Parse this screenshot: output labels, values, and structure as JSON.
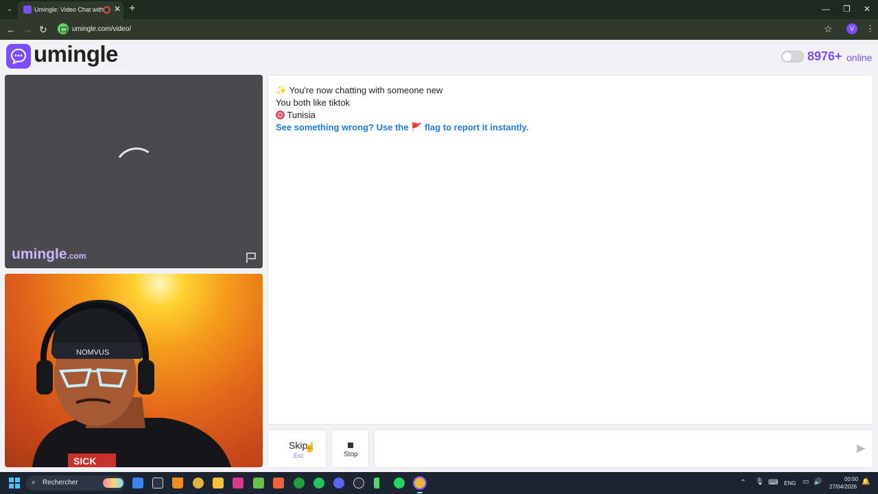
{
  "browser": {
    "tab_title": "Umingle: Video Chat with S",
    "url": "umingle.com/video/",
    "profile_initial": "V"
  },
  "header": {
    "logo_text": "umingle",
    "online_count": "8976+",
    "online_label": "online",
    "toggle_on": false
  },
  "remote_video": {
    "watermark": "umingle",
    "watermark_tld": ".com",
    "loading": true
  },
  "chat": {
    "line1_icon": "✨",
    "line1": "You're now chatting with someone new",
    "line2": "You both like tiktok",
    "country": "Tunisia",
    "report_prefix": "See something wrong? Use the",
    "report_flag": "🚩",
    "report_suffix": "flag to report it instantly."
  },
  "controls": {
    "skip_label": "Skip",
    "skip_key": "Esc",
    "stop_label": "Stop",
    "message_placeholder": ""
  },
  "taskbar": {
    "search_label": "Rechercher",
    "language": "ENG",
    "time": "00:50",
    "date": "27/04/2026"
  },
  "colors": {
    "brand": "#7c4dff",
    "report_link": "#1e7bd8"
  }
}
